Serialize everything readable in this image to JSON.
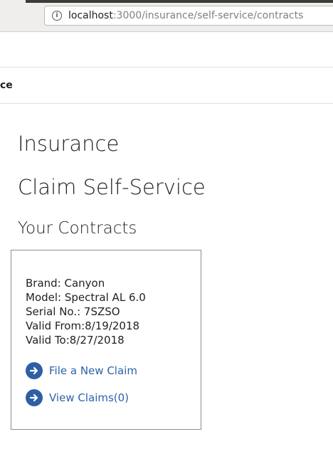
{
  "browser": {
    "url_host": "localhost",
    "url_path": ":3000/insurance/self-service/contracts"
  },
  "nav": {
    "title_fragment": "ce"
  },
  "page": {
    "title": "Insurance",
    "subtitle": "Claim Self-Service",
    "section_title": "Your Contracts"
  },
  "contract": {
    "brand": "Brand: Canyon",
    "model": "Model: Spectral AL 6.0",
    "serial": "Serial No.: 7SZSO",
    "valid_from": "Valid From:8/19/2018",
    "valid_to": "Valid To:8/27/2018",
    "actions": [
      {
        "label": "File a New Claim",
        "icon": "arrow-right-circle-icon"
      },
      {
        "label": "View Claims(0)",
        "icon": "arrow-right-circle-icon"
      }
    ]
  },
  "colors": {
    "link": "#2c63a8",
    "icon_bg": "#2d5fa3"
  }
}
